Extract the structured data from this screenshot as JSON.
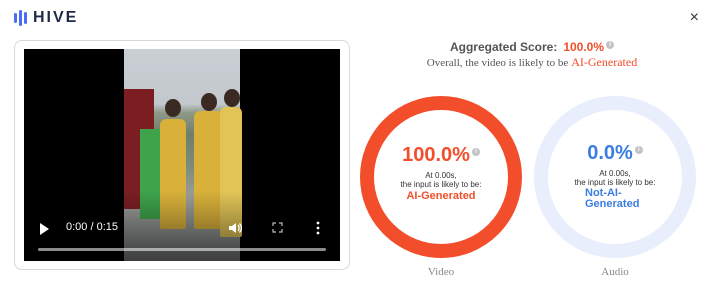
{
  "app": {
    "logo_text": "HIVE"
  },
  "header": {
    "close_label": "×"
  },
  "player": {
    "time": "0:00 / 0:15",
    "progress_fraction": 0.0
  },
  "aggregate": {
    "label": "Aggregated Score:",
    "score": "100.0%",
    "summary": "Overall, the video is likely to be",
    "verdict": "AI-Generated"
  },
  "video_result": {
    "score": "100.0%",
    "line1": "At 0.00s,",
    "line2": "the input is likely to be:",
    "result": "AI-Generated",
    "caption": "Video"
  },
  "audio_result": {
    "score": "0.0%",
    "line1": "At 0.00s,",
    "line2": "the input is likely to be:",
    "result": "Not-AI-Generated",
    "caption": "Audio"
  },
  "colors": {
    "ai": "#f24e2c",
    "not_ai": "#3b7de0",
    "brand": "#4a6cf7"
  },
  "icons": [
    "hive-logo-icon",
    "close-icon",
    "play-icon",
    "volume-icon",
    "fullscreen-icon",
    "more-options-icon",
    "info-icon"
  ]
}
